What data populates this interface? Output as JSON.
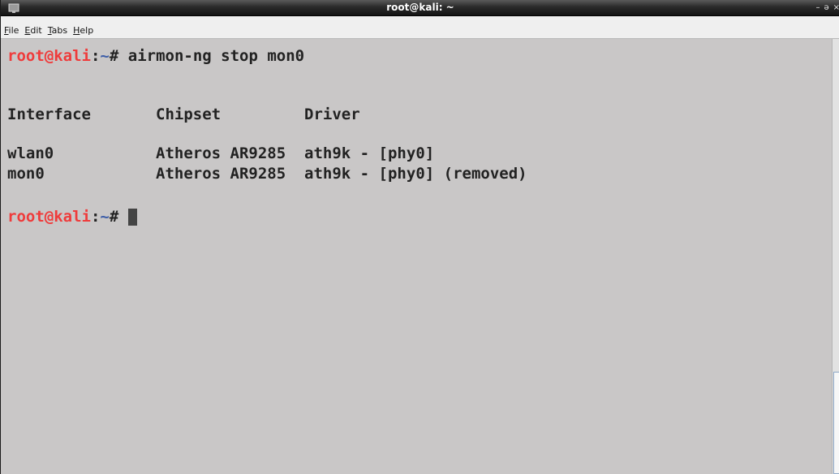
{
  "window": {
    "title": "root@kali: ~",
    "controls": [
      "–",
      "ə",
      "×"
    ]
  },
  "menu": {
    "file": {
      "mnemonic": "F",
      "rest": "ile"
    },
    "edit": {
      "mnemonic": "E",
      "rest": "dit"
    },
    "tabs": {
      "mnemonic": "T",
      "rest": "abs"
    },
    "help": {
      "mnemonic": "H",
      "rest": "elp"
    }
  },
  "terminal": {
    "prompt_user": "root@kali",
    "prompt_sep": ":",
    "prompt_path": "~",
    "prompt_suffix": "# ",
    "command": "airmon-ng stop mon0",
    "header": "Interface       Chipset         Driver",
    "rows": [
      "wlan0           Atheros AR9285  ath9k - [phy0]",
      "mon0            Atheros AR9285  ath9k - [phy0] (removed)"
    ]
  }
}
